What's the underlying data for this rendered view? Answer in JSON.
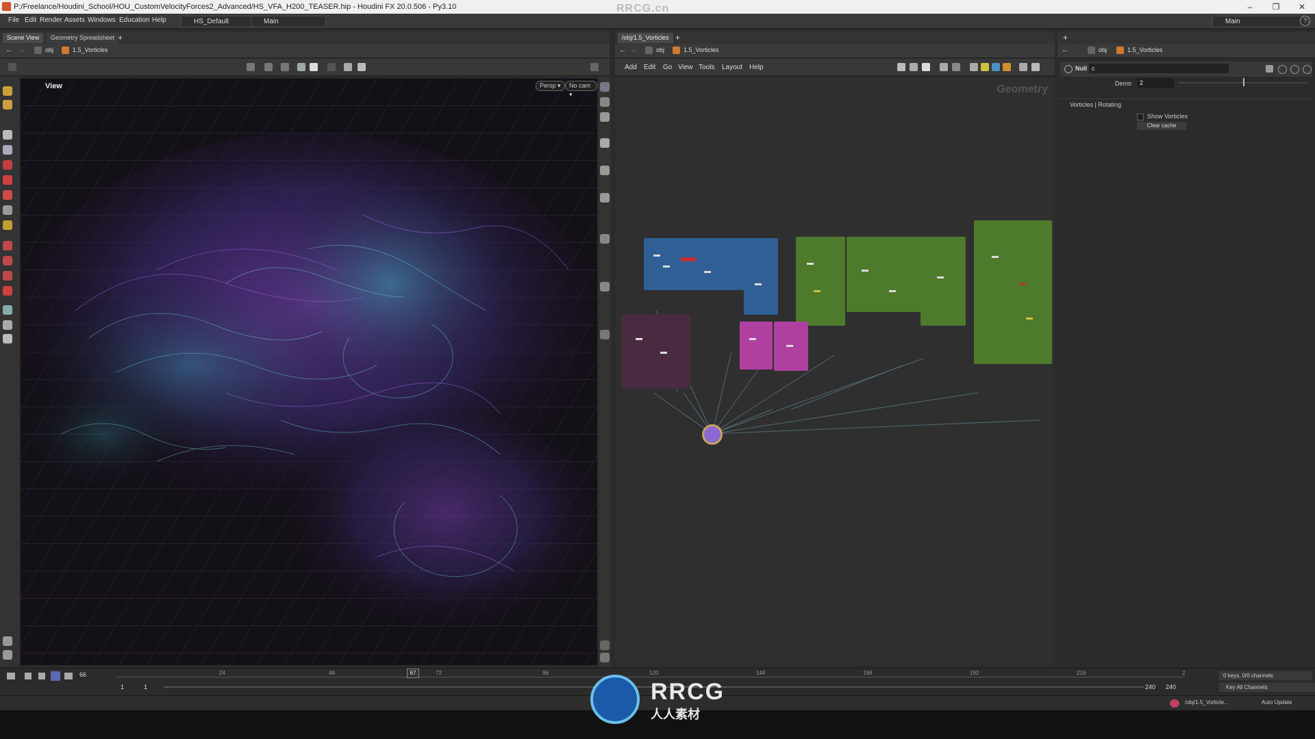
{
  "window": {
    "title": "P:/Freelance/Houdini_School/HOU_CustomVelocityForces2_Advanced/HS_VFA_H200_TEASER.hip - Houdini FX 20.0.506 - Py3.10",
    "watermark": "RRCG.cn",
    "controls": [
      "–",
      "❐",
      "✕"
    ]
  },
  "menu": {
    "items": [
      "File",
      "Edit",
      "Render",
      "Assets",
      "Windows",
      "Education",
      "Help"
    ],
    "desktop": "HS_Default",
    "context": "Main",
    "right_desktop": "Main"
  },
  "left_pane": {
    "tabs": [
      "Scene View",
      "Geometry Spreadsheet"
    ],
    "path": [
      "obj",
      "1.5_Vorticles"
    ],
    "view_label": "View",
    "persp": "Persp ▾",
    "cam": "No cam ▾"
  },
  "network_pane": {
    "tab": "/obj/1.5_Vorticles",
    "path": [
      "obj",
      "1.5_Vorticles"
    ],
    "menu": [
      "Add",
      "Edit",
      "Go",
      "View",
      "Tools",
      "Layout",
      "Help"
    ],
    "context_label": "Geometry"
  },
  "param_pane": {
    "path": [
      "obj",
      "1.5_Vorticles"
    ],
    "node_type": "Null",
    "node_name": "c",
    "demo_label": "Demo",
    "demo_value": "2",
    "demo_slider": 0.5,
    "tabs_label": "Vorticles | Rotating",
    "show_vorticles_label": "Show Vorticles",
    "clear_cache_label": "Clear cache"
  },
  "timeline": {
    "current_frame": "66",
    "marker_frame": "67",
    "ticks": [
      "24",
      "48",
      "72",
      "96",
      "120",
      "144",
      "168",
      "192",
      "216",
      "2"
    ],
    "start_a": "1",
    "start_b": "1",
    "end_a": "240",
    "end_b": "240",
    "keys_info": "0 keys, 0/0 channels",
    "key_all": "Key All Channels"
  },
  "status": {
    "path": "/obj/1.5_Vorticle...",
    "auto_update": "Auto Update"
  },
  "brand": {
    "logo_text": "RRCG",
    "logo_sub": "人人素材"
  },
  "colors": {
    "accent": "#e8863a",
    "blue_box": "#2f5f95",
    "green_box": "#4e7a2c",
    "pink_box": "#b040a0",
    "maroon_box": "#4a2a40",
    "null_node": "#8a6ad0"
  }
}
